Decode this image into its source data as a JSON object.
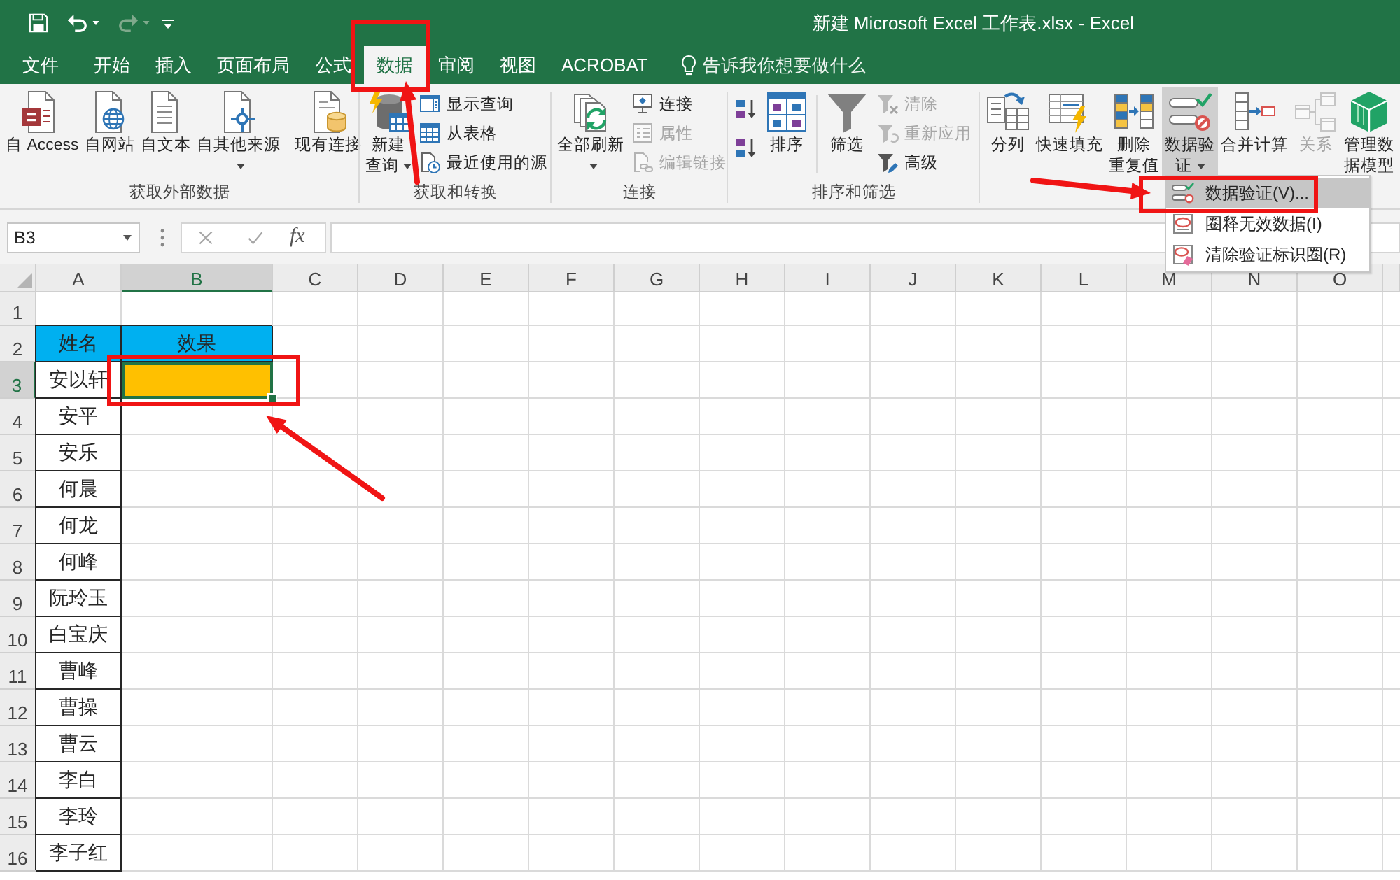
{
  "window": {
    "title": "新建 Microsoft Excel 工作表.xlsx - Excel"
  },
  "quick_access": [
    {
      "disabled": false
    },
    {
      "disabled": false
    },
    {
      "disabled": true
    },
    {
      "disabled": false
    }
  ],
  "tabs": [
    {
      "label": "文件",
      "selected": false
    },
    {
      "label": "开始",
      "selected": false
    },
    {
      "label": "插入",
      "selected": false
    },
    {
      "label": "页面布局",
      "selected": false
    },
    {
      "label": "公式",
      "selected": false
    },
    {
      "label": "数据",
      "selected": true
    },
    {
      "label": "审阅",
      "selected": false
    },
    {
      "label": "视图",
      "selected": false
    },
    {
      "label": "ACROBAT",
      "selected": false
    }
  ],
  "tell_me": {
    "placeholder": "告诉我你想要做什么"
  },
  "ribbon": {
    "groups": [
      {
        "label": "获取外部数据",
        "sections": [
          [
            {
              "kind": "large",
              "lines": [
                "自 Access"
              ],
              "menu": false,
              "disabled": false,
              "expanded": false
            },
            {
              "kind": "large",
              "lines": [
                "自网站"
              ],
              "menu": false,
              "disabled": false,
              "expanded": false
            },
            {
              "kind": "large",
              "lines": [
                "自文本"
              ],
              "menu": false,
              "disabled": false,
              "expanded": false
            },
            {
              "kind": "large",
              "lines": [
                "自其他来源"
              ],
              "menu": true,
              "disabled": false,
              "expanded": false
            }
          ],
          [
            {
              "kind": "large",
              "lines": [
                "现有连接"
              ],
              "menu": false,
              "disabled": false,
              "expanded": false
            }
          ]
        ]
      },
      {
        "label": "获取和转换",
        "sections": [
          [
            {
              "kind": "large",
              "lines": [
                "新建",
                "查询"
              ],
              "menu": true,
              "disabled": false,
              "expanded": false
            },
            {
              "kind": "stack",
              "items": [
                {
                  "kind": "small",
                  "label": "显示查询",
                  "disabled": false
                },
                {
                  "kind": "small",
                  "label": "从表格",
                  "disabled": false
                },
                {
                  "kind": "small",
                  "label": "最近使用的源",
                  "disabled": false
                }
              ]
            }
          ]
        ]
      },
      {
        "label": "连接",
        "sections": [
          [
            {
              "kind": "large",
              "lines": [
                "全部刷新"
              ],
              "menu": true,
              "disabled": false,
              "expanded": false
            },
            {
              "kind": "stack",
              "items": [
                {
                  "kind": "small",
                  "label": "连接",
                  "disabled": false
                },
                {
                  "kind": "small",
                  "label": "属性",
                  "disabled": true
                },
                {
                  "kind": "small",
                  "label": "编辑链接",
                  "disabled": true
                }
              ]
            }
          ]
        ]
      },
      {
        "label": "排序和筛选",
        "sections": [
          [
            {
              "kind": "stack",
              "items": [
                {
                  "kind": "icon",
                  "disabled": false
                },
                {
                  "kind": "icon",
                  "disabled": false
                }
              ]
            },
            {
              "kind": "large",
              "lines": [
                "排序"
              ],
              "menu": false,
              "disabled": false,
              "expanded": false
            }
          ],
          [
            {
              "kind": "large",
              "lines": [
                "筛选"
              ],
              "menu": false,
              "disabled": false,
              "expanded": false
            },
            {
              "kind": "stack",
              "items": [
                {
                  "kind": "small",
                  "label": "清除",
                  "disabled": true
                },
                {
                  "kind": "small",
                  "label": "重新应用",
                  "disabled": true
                },
                {
                  "kind": "small",
                  "label": "高级",
                  "disabled": false
                }
              ]
            }
          ]
        ]
      },
      {
        "sections": [
          [
            {
              "kind": "large",
              "lines": [
                "分列"
              ],
              "menu": false,
              "disabled": false,
              "expanded": false
            },
            {
              "kind": "large",
              "lines": [
                "快速填充"
              ],
              "menu": false,
              "disabled": false,
              "expanded": false
            },
            {
              "kind": "large",
              "lines": [
                "删除",
                "重复值"
              ],
              "menu": false,
              "disabled": false,
              "expanded": false
            },
            {
              "kind": "large",
              "lines": [
                "数据验",
                "证"
              ],
              "menu": true,
              "disabled": false,
              "expanded": true
            },
            {
              "kind": "large",
              "lines": [
                "合并计算"
              ],
              "menu": false,
              "disabled": false,
              "expanded": false
            },
            {
              "kind": "large",
              "lines": [
                "关系"
              ],
              "menu": false,
              "disabled": true,
              "expanded": false
            },
            {
              "kind": "large",
              "lines": [
                "管理数",
                "据模型"
              ],
              "menu": false,
              "disabled": false,
              "expanded": false
            }
          ]
        ]
      }
    ]
  },
  "dropdown_menu": {
    "items": [
      {
        "label": "数据验证(V)...",
        "selected": true
      },
      {
        "label": "圈释无效数据(I)",
        "selected": false
      },
      {
        "label": "清除验证标识圈(R)",
        "selected": false
      }
    ]
  },
  "formula_bar": {
    "name_box": "B3",
    "function_button": "fx"
  },
  "sheet": {
    "columns": [
      {
        "label": "A",
        "selected": false
      },
      {
        "label": "B",
        "selected": true
      },
      {
        "label": "C",
        "selected": false
      },
      {
        "label": "D",
        "selected": false
      },
      {
        "label": "E",
        "selected": false
      },
      {
        "label": "F",
        "selected": false
      },
      {
        "label": "G",
        "selected": false
      },
      {
        "label": "H",
        "selected": false
      },
      {
        "label": "I",
        "selected": false
      },
      {
        "label": "J",
        "selected": false
      },
      {
        "label": "K",
        "selected": false
      },
      {
        "label": "L",
        "selected": false
      },
      {
        "label": "M",
        "selected": false
      },
      {
        "label": "N",
        "selected": false
      },
      {
        "label": "O",
        "selected": false
      }
    ],
    "rows": [
      {
        "label": "1",
        "selected": false
      },
      {
        "label": "2",
        "selected": false,
        "cells": [
          {
            "text": "姓名",
            "color": "#00b0f0",
            "selected": false
          },
          {
            "text": "效果",
            "color": "#00b0f0",
            "selected": false
          }
        ]
      },
      {
        "label": "3",
        "selected": true,
        "cells": [
          {
            "text": "安以轩",
            "selected": false
          },
          {
            "color": "#ffc000",
            "selected": true
          }
        ]
      },
      {
        "label": "4",
        "selected": false,
        "cells": [
          {
            "text": "安平",
            "selected": false
          }
        ]
      },
      {
        "label": "5",
        "selected": false,
        "cells": [
          {
            "text": "安乐",
            "selected": false
          }
        ]
      },
      {
        "label": "6",
        "selected": false,
        "cells": [
          {
            "text": "何晨",
            "selected": false
          }
        ]
      },
      {
        "label": "7",
        "selected": false,
        "cells": [
          {
            "text": "何龙",
            "selected": false
          }
        ]
      },
      {
        "label": "8",
        "selected": false,
        "cells": [
          {
            "text": "何峰",
            "selected": false
          }
        ]
      },
      {
        "label": "9",
        "selected": false,
        "cells": [
          {
            "text": "阮玲玉",
            "selected": false
          }
        ]
      },
      {
        "label": "10",
        "selected": false,
        "cells": [
          {
            "text": "白宝庆",
            "selected": false
          }
        ]
      },
      {
        "label": "11",
        "selected": false,
        "cells": [
          {
            "text": "曹峰",
            "selected": false
          }
        ]
      },
      {
        "label": "12",
        "selected": false,
        "cells": [
          {
            "text": "曹操",
            "selected": false
          }
        ]
      },
      {
        "label": "13",
        "selected": false,
        "cells": [
          {
            "text": "曹云",
            "selected": false
          }
        ]
      },
      {
        "label": "14",
        "selected": false,
        "cells": [
          {
            "text": "李白",
            "selected": false
          }
        ]
      },
      {
        "label": "15",
        "selected": false,
        "cells": [
          {
            "text": "李玲",
            "selected": false
          }
        ]
      },
      {
        "label": "16",
        "selected": false,
        "cells": [
          {
            "text": "李子红",
            "selected": false
          }
        ]
      }
    ]
  }
}
